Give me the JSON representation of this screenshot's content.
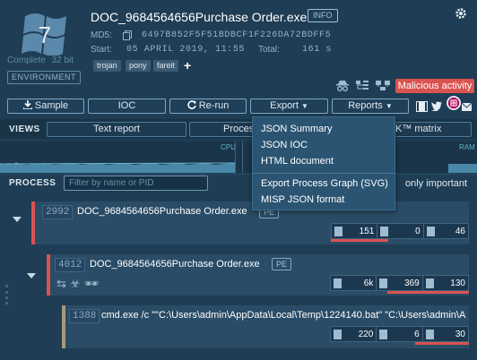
{
  "header": {
    "os_version": "7",
    "complete_label": "Complete",
    "bitness": "32 bit",
    "environment_label": "ENVIRONMENT",
    "filename": "DOC_9684564656Purchase Order.exe",
    "info_label": "INFO",
    "md5_label": "MD5:",
    "md5_value": "6497B852F5F51BDBCF1F226DA72BDFF5",
    "start_label": "Start:",
    "start_value": "05 APRIL 2019, 11:55",
    "total_label": "Total:",
    "total_value": "161 s",
    "tags": [
      "trojan",
      "pony",
      "fareit"
    ],
    "add_tag": "+",
    "verdict": "Malicious activity",
    "verdict_color": "#d9534f"
  },
  "toolbar": {
    "sample": "Sample",
    "ioc": "IOC",
    "rerun": "Re-run",
    "export": "Export",
    "reports": "Reports"
  },
  "views": {
    "label": "VIEWS",
    "text_report": "Text report",
    "process": "Proces",
    "matrix": "K™ matrix"
  },
  "graph": {
    "cpu": "CPU",
    "ram": "RAM"
  },
  "process_bar": {
    "label": "PROCESS",
    "filter_placeholder": "Filter by name or PID",
    "only_important": "only important"
  },
  "export_menu": [
    "JSON Summary",
    "JSON IOC",
    "HTML document",
    "Export Process Graph (SVG)",
    "MISP JSON format"
  ],
  "processes": [
    {
      "pid": "2992",
      "name": "DOC_9684564656Purchase Order.exe",
      "badge": "PE",
      "stats": [
        "151",
        "0",
        "46"
      ]
    },
    {
      "pid": "4012",
      "name": "DOC_9684564656Purchase Order.exe",
      "badge": "PE",
      "stats": [
        "6k",
        "369",
        "130"
      ]
    },
    {
      "pid": "1388",
      "name": "cmd.exe /c \"\"C:\\Users\\admin\\AppData\\Local\\Temp\\1224140.bat\" \"C:\\Users\\admin\\A",
      "stats": [
        "220",
        "6",
        "30"
      ]
    }
  ],
  "icons": [
    "gear-icon",
    "windows-logo-icon",
    "copy-icon",
    "download-icon",
    "refresh-icon",
    "caret-down-icon",
    "film-icon",
    "twitter-icon",
    "mail-icon",
    "file-icon",
    "network-icon",
    "biohazard-icon",
    "spy-icon"
  ]
}
